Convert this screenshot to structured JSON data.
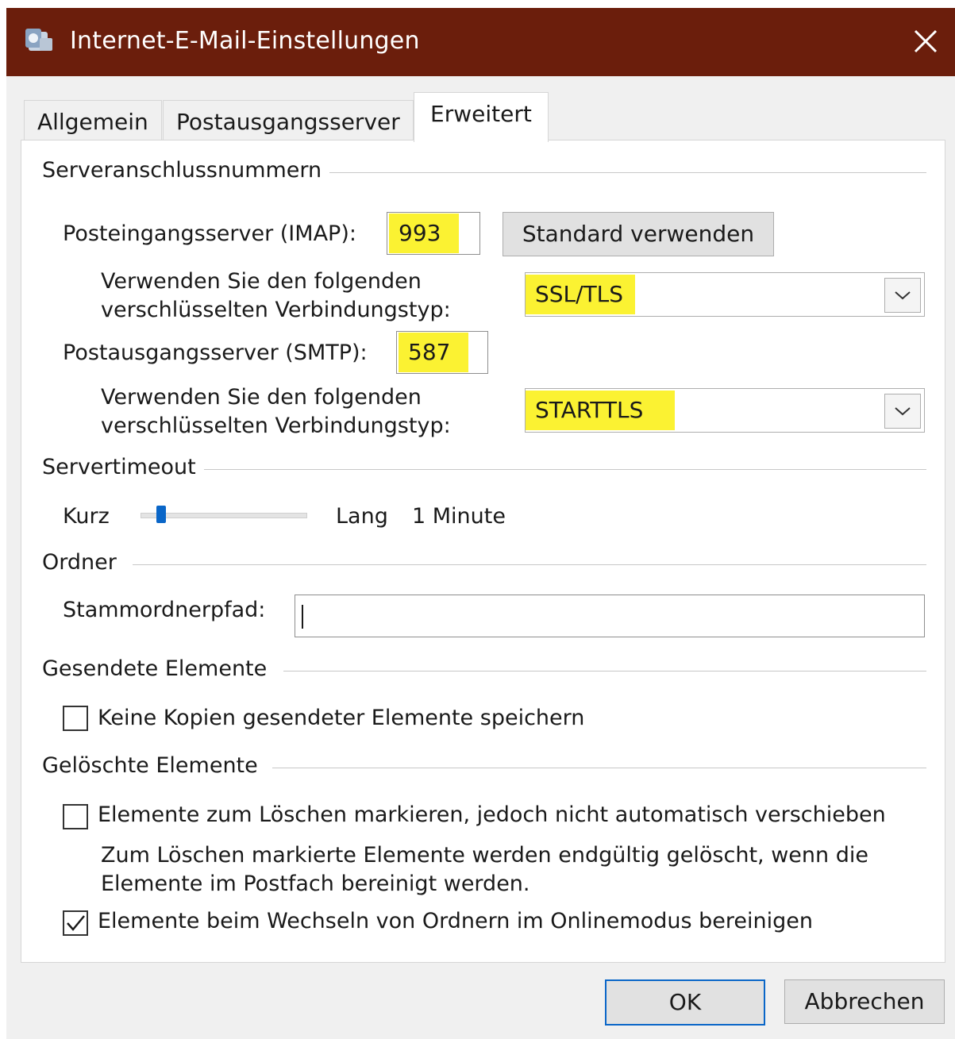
{
  "window": {
    "title": "Internet-E-Mail-Einstellungen",
    "title_bar_color": "#6b1e0c",
    "icon": "outlook-app-icon"
  },
  "tabs": [
    {
      "label": "Allgemein",
      "active": false
    },
    {
      "label": "Postausgangsserver",
      "active": false
    },
    {
      "label": "Erweitert",
      "active": true
    }
  ],
  "server_ports": {
    "group_label": "Serveranschlussnummern",
    "incoming_label": "Posteingangsserver (IMAP):",
    "incoming_value": "993",
    "default_button": "Standard verwenden",
    "encryption_label_line1": "Verwenden Sie den folgenden",
    "encryption_label_line2": "verschlüsselten Verbindungstyp:",
    "incoming_encryption": "SSL/TLS",
    "outgoing_label": "Postausgangsserver (SMTP):",
    "outgoing_value": "587",
    "outgoing_encryption": "STARTTLS",
    "highlight_color": "#fbf232"
  },
  "timeout": {
    "group_label": "Servertimeout",
    "short_label": "Kurz",
    "long_label": "Lang",
    "value_label": "1 Minute",
    "slider_level": 0.1
  },
  "folders": {
    "group_label": "Ordner",
    "root_path_label": "Stammordnerpfad:",
    "root_path_value": ""
  },
  "sent_items": {
    "group_label": "Gesendete Elemente",
    "no_copies_label": "Keine Kopien gesendeter Elemente speichern",
    "no_copies_checked": false
  },
  "deleted_items": {
    "group_label": "Gelöschte Elemente",
    "mark_label": "Elemente zum Löschen markieren, jedoch nicht automatisch verschieben",
    "mark_checked": false,
    "info_line1": "Zum Löschen markierte Elemente werden endgültig gelöscht, wenn die",
    "info_line2": "Elemente im Postfach bereinigt werden.",
    "purge_label": "Elemente beim Wechseln von Ordnern im Onlinemodus bereinigen",
    "purge_checked": true
  },
  "footer": {
    "ok_label": "OK",
    "cancel_label": "Abbrechen"
  }
}
